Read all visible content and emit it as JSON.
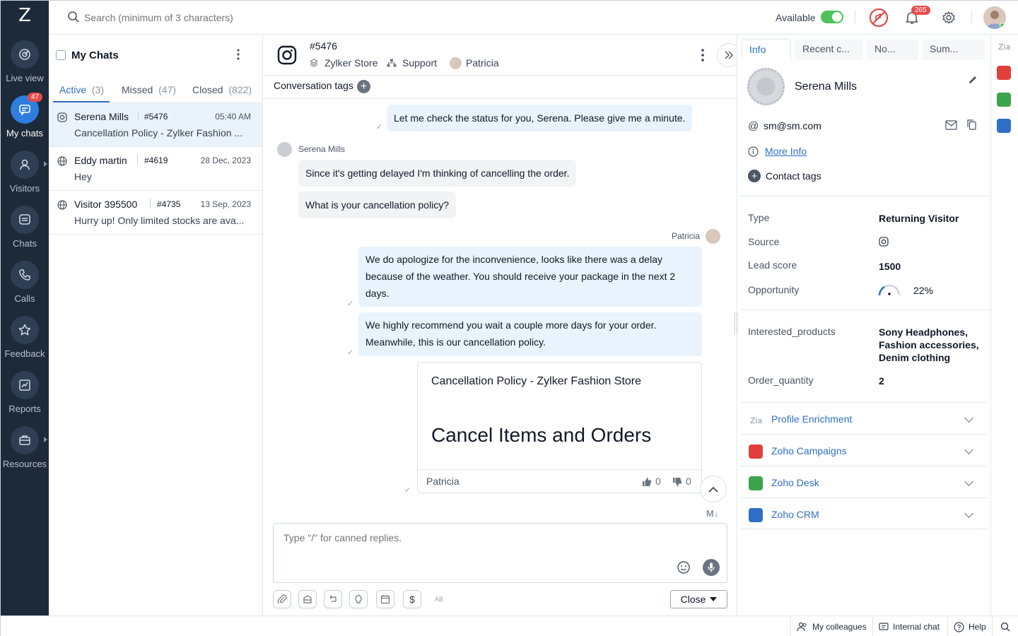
{
  "nav": {
    "logo": "Z",
    "items": [
      {
        "label": "Live view",
        "icon": "live-view-icon"
      },
      {
        "label": "My chats",
        "icon": "chat-bubble-icon",
        "badge": "47"
      },
      {
        "label": "Visitors",
        "icon": "user-icon"
      },
      {
        "label": "Chats",
        "icon": "chats-icon"
      },
      {
        "label": "Calls",
        "icon": "phone-icon"
      },
      {
        "label": "Feedback",
        "icon": "star-icon"
      },
      {
        "label": "Reports",
        "icon": "reports-icon"
      },
      {
        "label": "Resources",
        "icon": "briefcase-icon"
      }
    ]
  },
  "topbar": {
    "search_placeholder": "Search (minimum of 3 characters)",
    "status": "Available",
    "notif_count": "265"
  },
  "chatlist": {
    "title": "My Chats",
    "tabs": [
      {
        "label": "Active",
        "count": "(3)"
      },
      {
        "label": "Missed",
        "count": "(47)"
      },
      {
        "label": "Closed",
        "count": "(822)"
      }
    ],
    "rows": [
      {
        "name": "Serena Mills",
        "id": "#5476",
        "time": "05:40 AM",
        "preview": "Cancellation Policy - Zylker Fashion ..."
      },
      {
        "name": "Eddy martin",
        "id": "#4619",
        "time": "28 Dec, 2023",
        "preview": "Hey"
      },
      {
        "name": "Visitor 395500",
        "id": "#4735",
        "time": "13 Sep, 2023",
        "preview": "Hurry up! Only limited stocks are ava..."
      }
    ]
  },
  "conversation": {
    "id": "#5476",
    "store": "Zylker Store",
    "dept": "Support",
    "agent": "Patricia",
    "tags_label": "Conversation tags",
    "messages": {
      "m1": "Let me check the status for you, Serena. Please give me a minute.",
      "visitor_name": "Serena Mills",
      "m2": "Since it's getting delayed I'm thinking of cancelling the order.",
      "m3": "What is your cancellation policy?",
      "agent_name": "Patricia",
      "m4": "We do apologize for the inconvenience, looks like there was a delay because of the weather. You should receive your package in the next 2 days.",
      "m5": "We highly recommend you wait a couple more days for your order. Meanwhile, this is our cancellation policy."
    },
    "card": {
      "title": "Cancellation Policy - Zylker Fashion Store",
      "heading": "Cancel Items and Orders",
      "author": "Patricia",
      "likes": "0",
      "dislikes": "0"
    },
    "md_label": "M↓",
    "input_placeholder": "Type \"/\" for canned replies.",
    "close_label": "Close",
    "tool_ab": "AB"
  },
  "info": {
    "tabs": [
      "Info",
      "Recent c...",
      "No...",
      "Sum..."
    ],
    "name": "Serena Mills",
    "email": "sm@sm.com",
    "at": "@",
    "more_info": "More Info",
    "contact_tags": "Contact tags",
    "fields": [
      {
        "k": "Type",
        "v": "Returning Visitor"
      },
      {
        "k": "Source",
        "v": ""
      },
      {
        "k": "Lead score",
        "v": "1500"
      },
      {
        "k": "Opportunity",
        "v": "22%"
      }
    ],
    "fields2": [
      {
        "k": "Interested_products",
        "v": "Sony Headphones, Fashion accessories, Denim clothing"
      },
      {
        "k": "Order_quantity",
        "v": "2"
      }
    ],
    "integrations": [
      {
        "label": "Profile Enrichment",
        "color": "#8a94a3"
      },
      {
        "label": "Zoho Campaigns",
        "color": "#e0403b"
      },
      {
        "label": "Zoho Desk",
        "color": "#3ca34d"
      },
      {
        "label": "Zoho CRM",
        "color": "#2f6fc5"
      }
    ]
  },
  "bottombar": {
    "colleagues": "My colleagues",
    "internal": "Internal chat",
    "help": "Help"
  }
}
